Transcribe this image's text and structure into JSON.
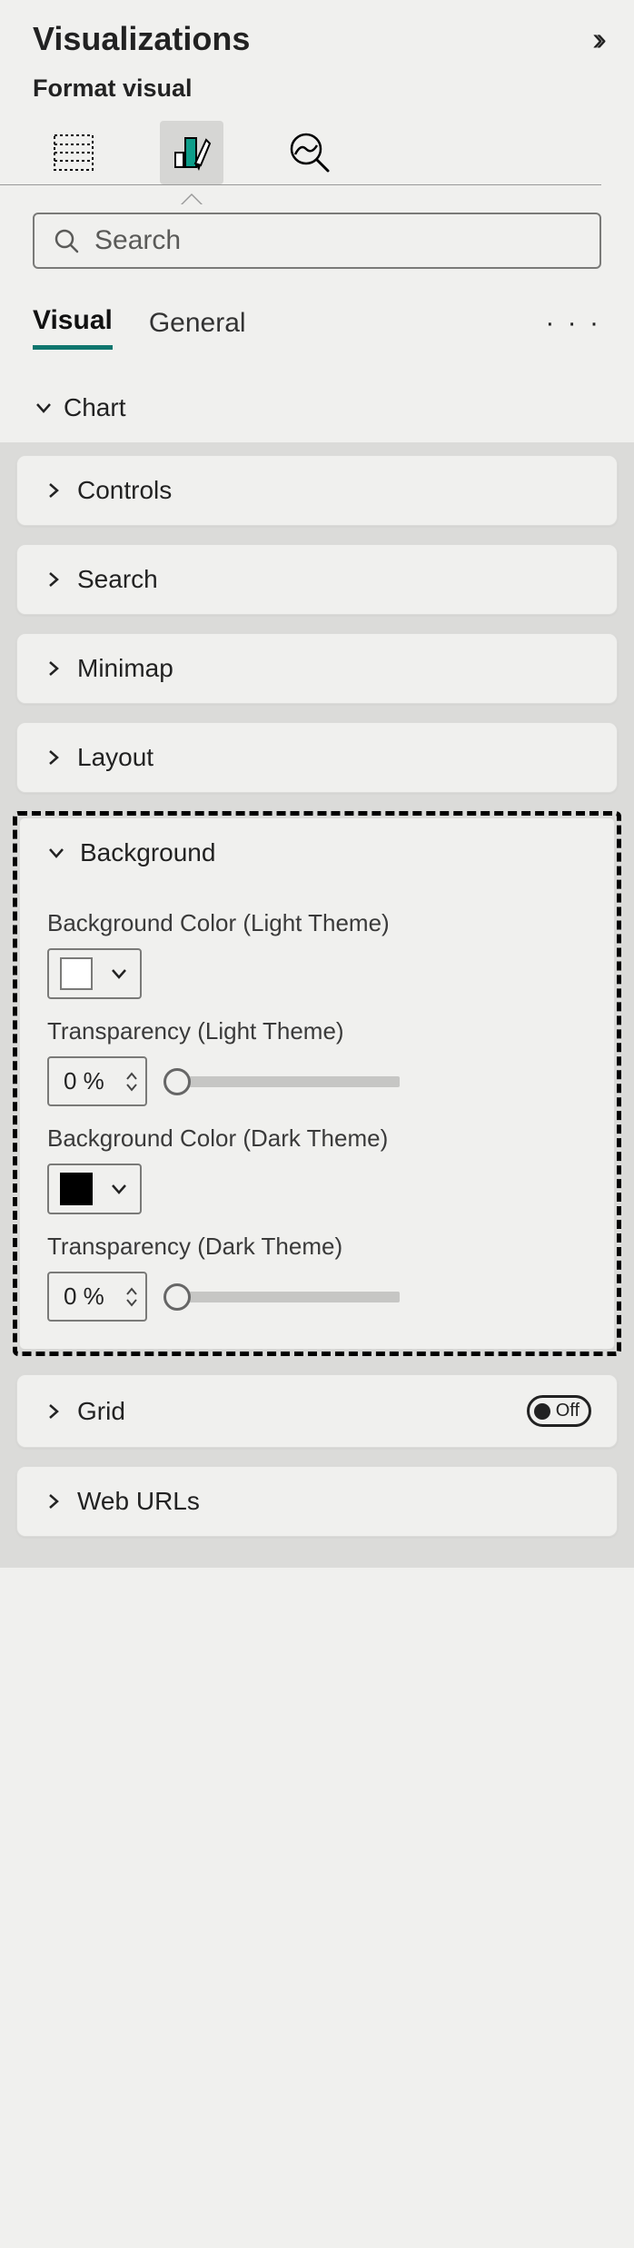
{
  "header": {
    "title": "Visualizations",
    "subtitle": "Format visual"
  },
  "search": {
    "placeholder": "Search"
  },
  "tabs": {
    "visual": "Visual",
    "general": "General"
  },
  "section": {
    "chart": "Chart"
  },
  "cards": {
    "controls": "Controls",
    "search": "Search",
    "minimap": "Minimap",
    "layout": "Layout",
    "background": {
      "title": "Background",
      "bg_color_light_label": "Background Color (Light Theme)",
      "transparency_light_label": "Transparency (Light Theme)",
      "transparency_light_value": "0 %",
      "bg_color_dark_label": "Background Color (Dark Theme)",
      "transparency_dark_label": "Transparency (Dark Theme)",
      "transparency_dark_value": "0 %"
    },
    "grid": {
      "title": "Grid",
      "toggle": "Off"
    },
    "web_urls": "Web URLs"
  }
}
